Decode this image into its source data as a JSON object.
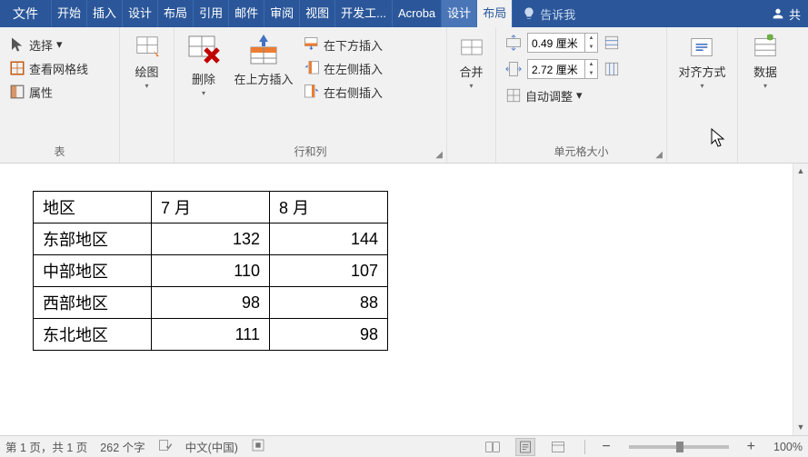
{
  "tabs": {
    "file": "文件",
    "items": [
      "开始",
      "插入",
      "设计",
      "布局",
      "引用",
      "邮件",
      "审阅",
      "视图",
      "开发工..."
    ],
    "acrobat": "Acroba",
    "contextual": [
      "设计",
      "布局"
    ],
    "tell_me": "告诉我",
    "share": "共"
  },
  "ribbon": {
    "table_group": {
      "label": "表",
      "select": "选择",
      "view_gridlines": "查看网格线",
      "properties": "属性"
    },
    "draw_group": {
      "draw": "绘图"
    },
    "rows_cols": {
      "label": "行和列",
      "delete": "删除",
      "insert_above": "在上方插入",
      "insert_below": "在下方插入",
      "insert_left": "在左侧插入",
      "insert_right": "在右侧插入"
    },
    "merge": {
      "merge": "合并"
    },
    "cell_size": {
      "label": "单元格大小",
      "height": "0.49 厘米",
      "width": "2.72 厘米",
      "autofit": "自动调整"
    },
    "align": {
      "label": "对齐方式"
    },
    "data": {
      "label": "数据"
    }
  },
  "chart_data": {
    "type": "table",
    "headers": [
      "地区",
      "7 月",
      "8 月"
    ],
    "rows": [
      {
        "region": "东部地区",
        "jul": "132",
        "aug": "144"
      },
      {
        "region": "中部地区",
        "jul": "110",
        "aug": "107"
      },
      {
        "region": "西部地区",
        "jul": "98",
        "aug": "88"
      },
      {
        "region": "东北地区",
        "jul": "111",
        "aug": "98"
      }
    ]
  },
  "status": {
    "page": "第 1 页，共 1 页",
    "words": "262 个字",
    "language": "中文(中国)",
    "zoom": "100%"
  }
}
